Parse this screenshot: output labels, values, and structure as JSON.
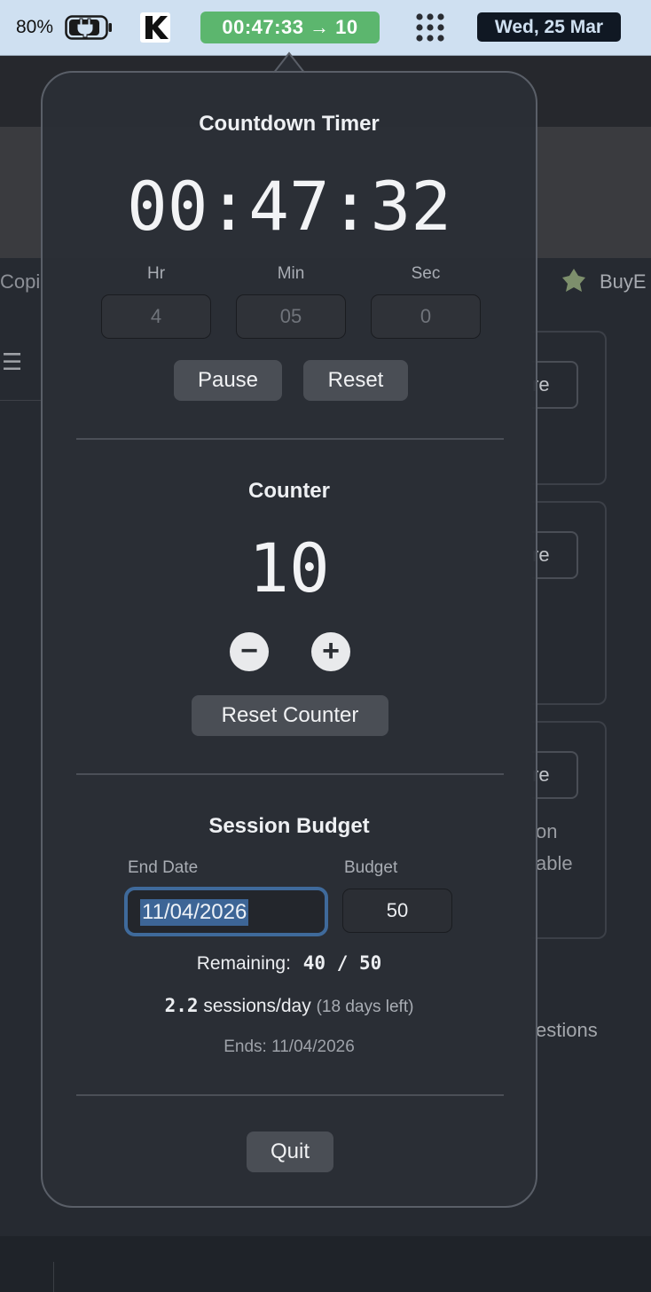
{
  "menubar": {
    "battery_percent": "80%",
    "timer_status": "00:47:33 → 10",
    "date": "Wed, 25 Mar"
  },
  "background_app": {
    "tab_left_text": "Copi",
    "tab_right_text": "BuyE",
    "card_button_suffix": "re",
    "card_texts": [
      "on",
      "able"
    ],
    "suggestions_text": "estions"
  },
  "popover": {
    "timer": {
      "title": "Countdown Timer",
      "display": "00:47:32",
      "labels": {
        "hr": "Hr",
        "min": "Min",
        "sec": "Sec"
      },
      "inputs": {
        "hr": "4",
        "min": "05",
        "sec": "0"
      },
      "pause_label": "Pause",
      "reset_label": "Reset"
    },
    "counter": {
      "title": "Counter",
      "value": "10",
      "decrement_symbol": "−",
      "increment_symbol": "+",
      "reset_label": "Reset Counter"
    },
    "budget": {
      "title": "Session Budget",
      "end_date_label": "End Date",
      "budget_label": "Budget",
      "end_date_value": "11/04/2026",
      "budget_value": "50",
      "remaining_label": "Remaining:",
      "remaining_value": "40 / 50",
      "rate_value": "2.2",
      "rate_unit": "sessions/day",
      "days_left": "(18 days left)",
      "ends_text": "Ends: 11/04/2026"
    },
    "quit_label": "Quit"
  }
}
